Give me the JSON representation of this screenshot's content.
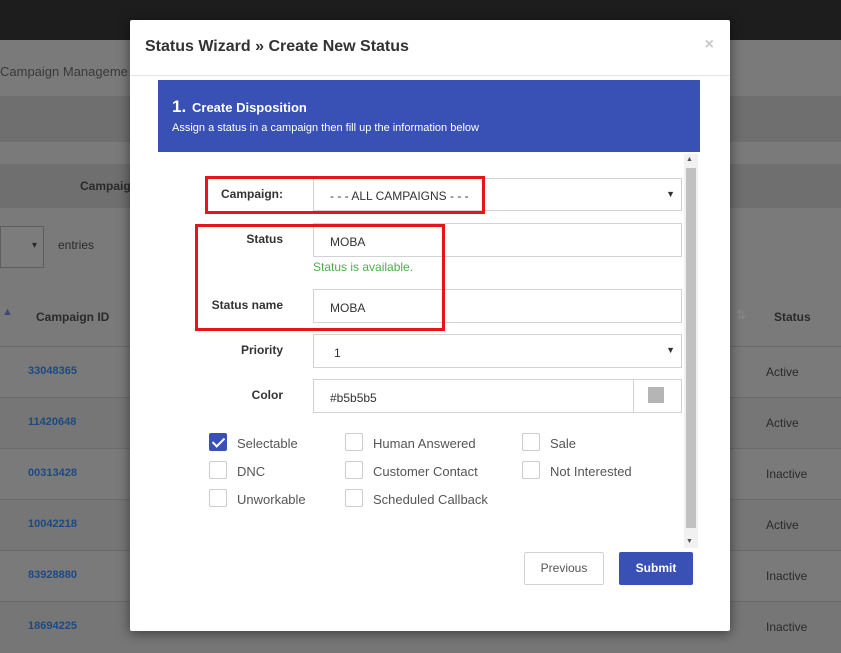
{
  "background": {
    "breadcrumb": "Campaign Manageme",
    "column_header_partial": "Campaig",
    "entries_label": "entries",
    "table_headers": {
      "campaign_id": "Campaign ID",
      "status": "Status"
    },
    "rows": [
      {
        "id": "33048365",
        "status": "Active"
      },
      {
        "id": "11420648",
        "status": "Active"
      },
      {
        "id": "00313428",
        "status": "Inactive"
      },
      {
        "id": "10042218",
        "status": "Active"
      },
      {
        "id": "83928880",
        "status": "Inactive"
      },
      {
        "id": "18694225",
        "status": "Inactive"
      }
    ]
  },
  "modal": {
    "title": "Status Wizard » Create New Status",
    "close_glyph": "×",
    "step": {
      "number": "1.",
      "title": "Create Disposition",
      "subtitle": "Assign a status in a campaign then fill up the information below"
    },
    "form": {
      "campaign_label": "Campaign:",
      "campaign_value": "- - - ALL CAMPAIGNS - - -",
      "status_label": "Status",
      "status_value": "MOBA",
      "status_available": "Status is available.",
      "status_name_label": "Status name",
      "status_name_value": "MOBA",
      "priority_label": "Priority",
      "priority_value": "1",
      "color_label": "Color",
      "color_value": "#b5b5b5"
    },
    "checkboxes": [
      {
        "label": "Selectable",
        "checked": true
      },
      {
        "label": "Human Answered",
        "checked": false
      },
      {
        "label": "Sale",
        "checked": false
      },
      {
        "label": "DNC",
        "checked": false
      },
      {
        "label": "Customer Contact",
        "checked": false
      },
      {
        "label": "Not Interested",
        "checked": false
      },
      {
        "label": "Unworkable",
        "checked": false
      },
      {
        "label": "Scheduled Callback",
        "checked": false
      }
    ],
    "buttons": {
      "previous": "Previous",
      "submit": "Submit"
    }
  },
  "colors": {
    "accent": "#3950b5",
    "highlight": "#e8141c",
    "available": "#4cae4c"
  }
}
